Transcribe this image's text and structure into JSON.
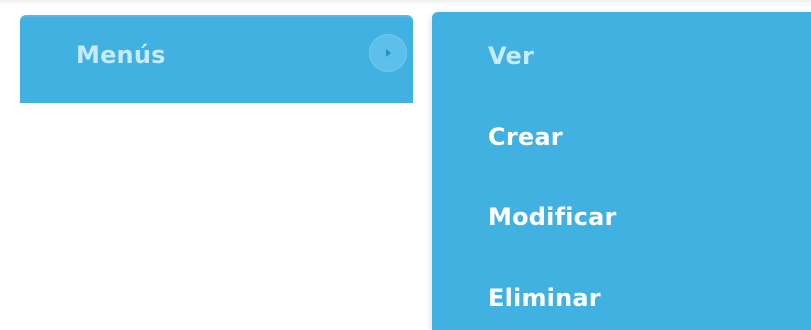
{
  "menu": {
    "label": "Menús",
    "expand_icon": "chevron-right-icon"
  },
  "submenu": {
    "items": [
      {
        "label": "Ver"
      },
      {
        "label": "Crear"
      },
      {
        "label": "Modificar"
      },
      {
        "label": "Eliminar"
      }
    ]
  },
  "colors": {
    "menu_background": "#40b1e1",
    "label_inactive": "#c7ebfa",
    "label_active": "#ffffff"
  }
}
